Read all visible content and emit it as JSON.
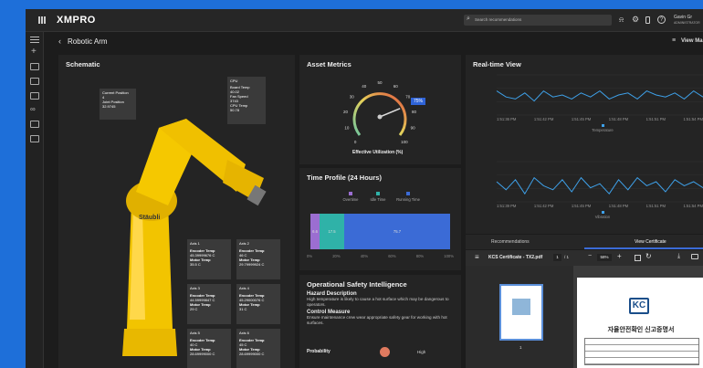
{
  "app": {
    "logo": "XMPRO",
    "search_placeholder": "Search recommendations",
    "user_name": "Gavin Gr",
    "user_role": "ADMINISTRATOR",
    "view_label": "View Ma"
  },
  "page": {
    "back_label": "Robotic Arm"
  },
  "schematic": {
    "title": "Schematic",
    "position": {
      "l1": "Current Position",
      "v1": "4",
      "l2": "Joint Position",
      "v2": "32.9745"
    },
    "cpu": {
      "header": "CPU",
      "l1": "Board Temp",
      "v1": "40.02",
      "l2": "Fan Speed",
      "v2": "3743",
      "l3": "CPU Temp",
      "v3": "50.78"
    },
    "axes": [
      {
        "name": "Axis 1",
        "enc": "Encoder Temp",
        "ev": "45.39999676 C",
        "mot": "Motor Temp",
        "mv": "35.5 C"
      },
      {
        "name": "Axis 2",
        "enc": "Encoder Temp",
        "ev": "46 C",
        "mot": "Motor Temp",
        "mv": "29.79999924 C"
      },
      {
        "name": "Axis 3",
        "enc": "Encoder Temp",
        "ev": "44.59999847 C",
        "mot": "Motor Temp",
        "mv": "29 C"
      },
      {
        "name": "Axis 4",
        "enc": "Encoder Temp",
        "ev": "45.29000076 C",
        "mot": "Motor Temp",
        "mv": "31 C"
      },
      {
        "name": "Axis 5",
        "enc": "Encoder Temp",
        "ev": "40 C",
        "mot": "Motor Temp",
        "mv": "28.69999000 C"
      },
      {
        "name": "Axis 6",
        "enc": "Encoder Temp",
        "ev": "45 C",
        "mot": "Motor Temp",
        "mv": "28.69999000 C"
      }
    ]
  },
  "metrics": {
    "title": "Asset Metrics",
    "gauge_labels": [
      "0",
      "10",
      "20",
      "30",
      "40",
      "50",
      "60",
      "70",
      "80",
      "90",
      "100"
    ],
    "value": "75%",
    "caption": "Effective Utilization (%)",
    "fraction": 0.75
  },
  "time_profile": {
    "title": "Time Profile (24 Hours)",
    "legend": [
      "Overtime",
      "Idle Time",
      "Running Time"
    ],
    "values": [
      "6.6",
      "17.5",
      "75.7"
    ],
    "ticks": [
      "0%",
      "20%",
      "40%",
      "60%",
      "80%",
      "100%"
    ]
  },
  "safety": {
    "title": "Operational Safety Intelligence",
    "h1": "Hazard Description",
    "p1": "High temperature is likely to cause a hot surface which may be dangerous to operators.",
    "h2": "Control Measure",
    "p2": "Ensure maintenance crew wear appropriate safety gear for working with hot surfaces.",
    "prob_label": "Probability",
    "prob_value": "High"
  },
  "realtime": {
    "title": "Real-time View",
    "chart1_label": "Temperature",
    "chart2_label": "Vibration",
    "ticks1": [
      "1:51:36 PM",
      "1:51:42 PM",
      "1:51:45 PM",
      "1:51:48 PM",
      "1:51:51 PM",
      "1:51:54 PM"
    ],
    "ticks2": [
      "1:51:39 PM",
      "1:51:42 PM",
      "1:51:45 PM",
      "1:51:48 PM",
      "1:51:51 PM",
      "1:51:54 PM"
    ]
  },
  "tabs": {
    "t1": "Recommendations",
    "t2": "View Certificate"
  },
  "pdf": {
    "file": "KCS Certificate - TX2.pdf",
    "page": "1",
    "pages": "/ 1",
    "zoom": "58%",
    "thumb_num": "1",
    "cert_title": "자율안전확인 신고증명서",
    "kc": "KC"
  },
  "chart_data": [
    {
      "type": "line",
      "series": [
        {
          "values": [
            60,
            45,
            40,
            55,
            35,
            60,
            45,
            50,
            40,
            55,
            45,
            60,
            40,
            50,
            55,
            40,
            60,
            50,
            45,
            55,
            40,
            60,
            45
          ]
        }
      ],
      "ylim": [
        0,
        100
      ]
    },
    {
      "type": "line",
      "series": [
        {
          "values": [
            50,
            30,
            55,
            20,
            60,
            40,
            30,
            55,
            25,
            60,
            35,
            45,
            20,
            55,
            30,
            60,
            40,
            50,
            25,
            55,
            40,
            50,
            35
          ]
        }
      ],
      "ylim": [
        0,
        100
      ]
    }
  ]
}
